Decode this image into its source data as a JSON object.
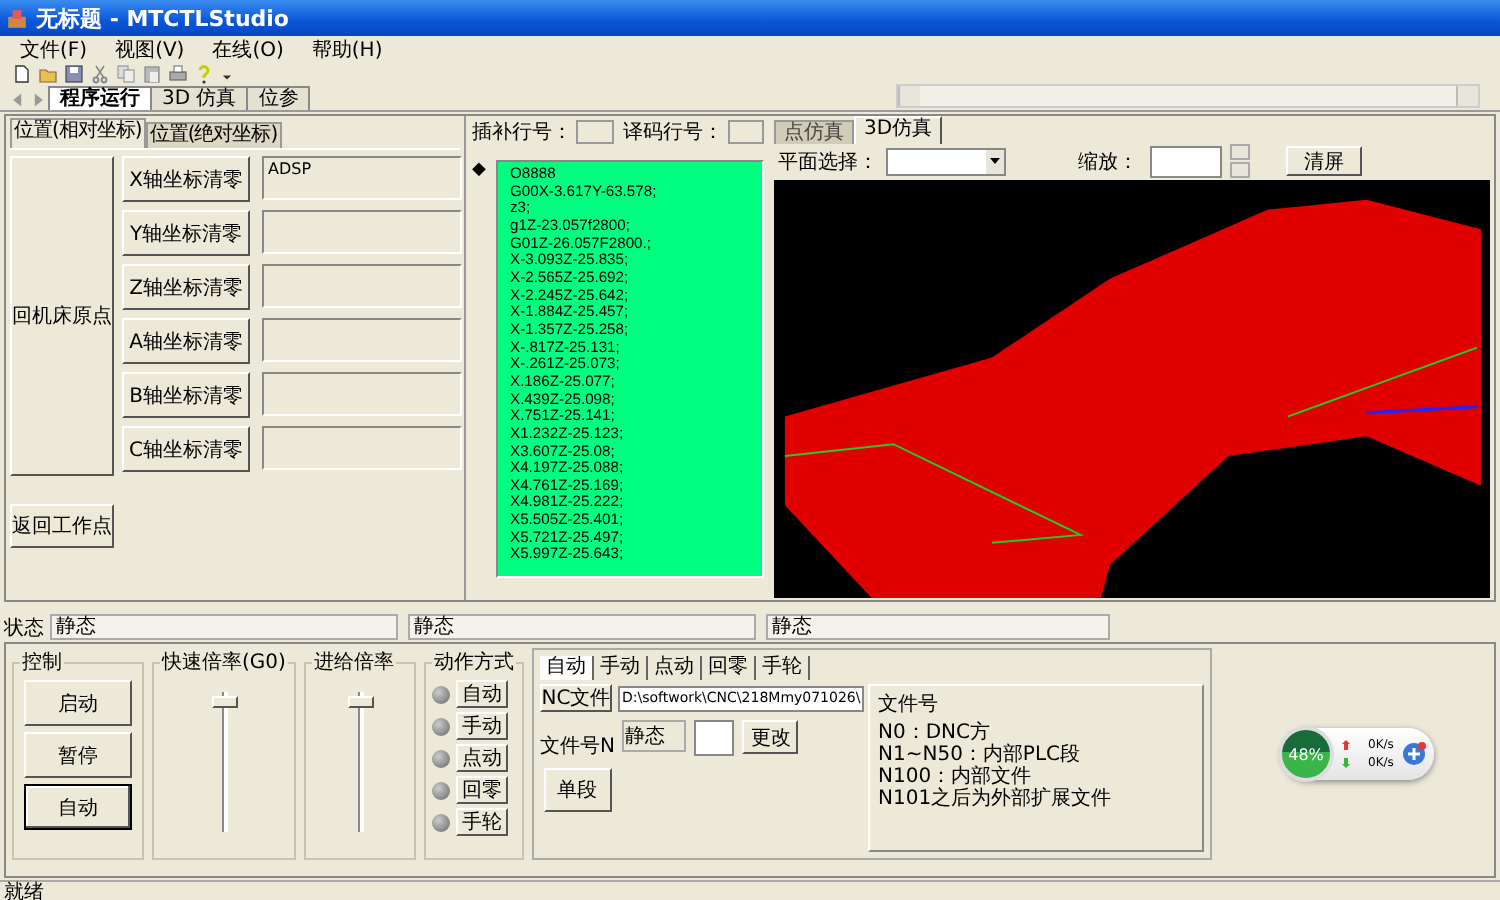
{
  "window": {
    "title": "无标题 - MTCTLStudio"
  },
  "menu": [
    "文件(F)",
    "视图(V)",
    "在线(O)",
    "帮助(H)"
  ],
  "main_tabs": [
    {
      "label": "程序运行",
      "selected": true
    },
    {
      "label": "3D 仿真",
      "selected": false
    },
    {
      "label": "位参",
      "selected": false
    }
  ],
  "position_tabs": [
    {
      "label": "位置(相对坐标)",
      "selected": true
    },
    {
      "label": "位置(绝对坐标)",
      "selected": false
    }
  ],
  "home_button": "回机床原点",
  "return_button": "返回工作点",
  "axes": [
    {
      "button": "X轴坐标清零",
      "value": "ADSP"
    },
    {
      "button": "Y轴坐标清零"
    },
    {
      "button": "Z轴坐标清零"
    },
    {
      "button": "A轴坐标清零"
    },
    {
      "button": "B轴坐标清零"
    },
    {
      "button": "C轴坐标清零"
    }
  ],
  "interp_line": {
    "label": "插补行号："
  },
  "decode_line": {
    "label": "译码行号："
  },
  "current_line_marker": "◆",
  "program_lines": [
    "O8888",
    "G00X-3.617Y-63.578;",
    "z3;",
    "g1Z-23.057f2800;",
    "G01Z-26.057F2800.;",
    "X-3.093Z-25.835;",
    "X-2.565Z-25.692;",
    "X-2.245Z-25.642;",
    "X-1.884Z-25.457;",
    "X-1.357Z-25.258;",
    "X-.817Z-25.131;",
    "X-.261Z-25.073;",
    "X.186Z-25.077;",
    "X.439Z-25.098;",
    "X.751Z-25.141;",
    "X1.232Z-25.123;",
    "X3.607Z-25.08;",
    "X4.197Z-25.088;",
    "X4.761Z-25.169;",
    "X4.981Z-25.222;",
    "X5.505Z-25.401;",
    "X5.721Z-25.497;",
    "X5.997Z-25.643;"
  ],
  "sim_tabs": [
    {
      "label": "点仿真",
      "selected": false
    },
    {
      "label": "3D仿真",
      "selected": true
    }
  ],
  "plane_select": {
    "label": "平面选择："
  },
  "zoom": {
    "label": "缩放："
  },
  "clear_button": "清屏",
  "status": {
    "label": "状态",
    "fields": [
      "静态",
      "静态",
      "静态"
    ]
  },
  "control": {
    "title": "控制",
    "buttons": [
      {
        "label": "启动",
        "selected": false
      },
      {
        "label": "暂停",
        "selected": false
      },
      {
        "label": "自动",
        "selected": true
      }
    ]
  },
  "rapid_rate": {
    "title": "快速倍率(G0)",
    "level": 0.97
  },
  "feed_rate": {
    "title": "进给倍率",
    "level": 0.97
  },
  "action_mode": {
    "title": "动作方式",
    "modes": [
      {
        "label": "自动",
        "on": false
      },
      {
        "label": "手动",
        "on": false
      },
      {
        "label": "点动",
        "on": false
      },
      {
        "label": "回零",
        "on": false
      },
      {
        "label": "手轮",
        "on": false
      }
    ]
  },
  "mode_tabs": [
    {
      "label": "自动",
      "selected": true
    },
    {
      "label": "手动",
      "selected": false
    },
    {
      "label": "点动",
      "selected": false
    },
    {
      "label": "回零",
      "selected": false
    },
    {
      "label": "手轮",
      "selected": false
    }
  ],
  "nc_file_button": "NC文件",
  "nc_path": "D:\\softwork\\CNC\\218Mmy071026\\",
  "file_number": {
    "label": "文件号N",
    "value": "静态"
  },
  "change_button": "更改",
  "single_step_button": "单段",
  "file_info": {
    "title": "文件号",
    "lines": [
      "N0：DNC方",
      "N1~N50：内部PLC段",
      "N100：内部文件",
      "N101之后为外部扩展文件"
    ]
  },
  "speed_widget": {
    "percent": "48%",
    "upload": "0K/s",
    "download": "0K/s"
  },
  "status_bar": "就绪"
}
